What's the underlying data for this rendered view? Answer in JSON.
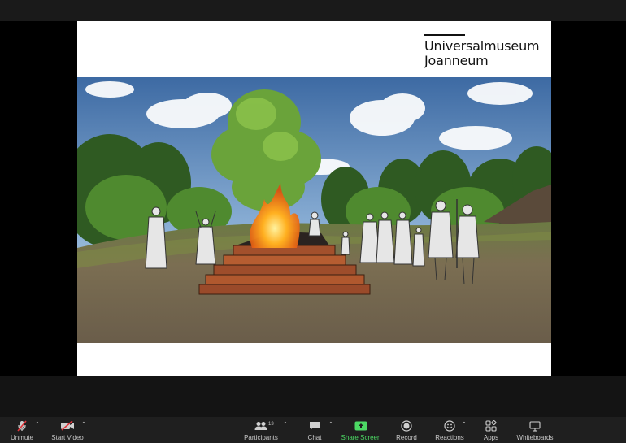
{
  "slide": {
    "logo_line1": "Universalmuseum",
    "logo_line2": "Joanneum"
  },
  "toolbar": {
    "unmute": "Unmute",
    "start_video": "Start Video",
    "participants": "Participants",
    "participants_count": "13",
    "chat": "Chat",
    "share_screen": "Share Screen",
    "record": "Record",
    "reactions": "Reactions",
    "apps": "Apps",
    "whiteboards": "Whiteboards"
  },
  "colors": {
    "toolbar_bg": "#1f1f1f",
    "share_green": "#4cd964",
    "mute_red": "#e0343a"
  }
}
